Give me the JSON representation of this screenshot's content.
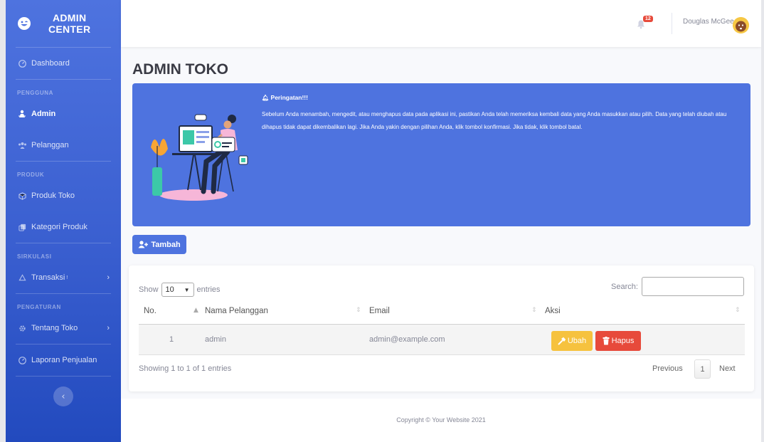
{
  "brand": {
    "line1": "ADMIN",
    "line2": "CENTER"
  },
  "sidebar": {
    "dashboard": "Dashboard",
    "heading_pengguna": "PENGGUNA",
    "admin": "Admin",
    "pelanggan": "Pelanggan",
    "heading_produk": "PRODUK",
    "produk_toko": "Produk Toko",
    "kategori_produk": "Kategori Produk",
    "heading_sirkulasi": "SIRKULASI",
    "transaksi": "Transaksi",
    "transaksi_badge": "!",
    "heading_pengaturan": "PENGATURAN",
    "tentang_toko": "Tentang Toko",
    "laporan_penjualan": "Laporan Penjualan"
  },
  "topbar": {
    "alert_count": "12",
    "user_name": "Douglas McGee"
  },
  "page": {
    "title": "ADMIN TOKO"
  },
  "alert": {
    "title": "Peringatan!!!",
    "body": "Sebelum Anda menambah, mengedit, atau menghapus data pada aplikasi ini, pastikan Anda telah memeriksa kembali data yang Anda masukkan atau pilih. Data yang telah diubah atau dihapus tidak dapat dikembalikan lagi. Jika Anda yakin dengan pilihan Anda, klik tombol konfirmasi. Jika tidak, klik tombol batal."
  },
  "actions": {
    "tambah": "Tambah"
  },
  "table": {
    "show": "Show",
    "entries_value": "10",
    "entries": "entries",
    "search_label": "Search:",
    "headers": {
      "no": "No.",
      "nama": "Nama Pelanggan",
      "email": "Email",
      "aksi": "Aksi"
    },
    "rows": [
      {
        "no": "1",
        "nama": "admin",
        "email": "admin@example.com",
        "ubah": "Ubah",
        "hapus": "Hapus"
      }
    ],
    "info": "Showing 1 to 1 of 1 entries",
    "previous": "Previous",
    "page": "1",
    "next": "Next"
  },
  "footer": {
    "copyright": "Copyright © Your Website 2021"
  },
  "colors": {
    "primary": "#4e73df",
    "warning": "#f6c23e",
    "danger": "#e74a3b"
  }
}
